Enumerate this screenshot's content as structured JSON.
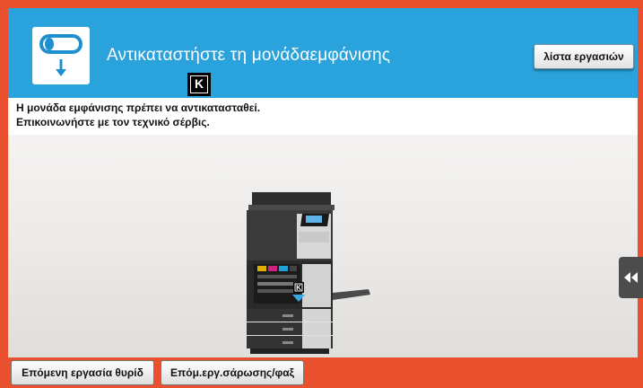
{
  "header": {
    "title": "Αντικαταστήστε τη μονάδαεμφάνισης",
    "toner_badge": "K",
    "job_list_label": "λίστα εργασιών",
    "icon": "drum-unit-replace-icon"
  },
  "message": {
    "line1": "Η μονάδα εμφάνισης πρέπει να αντικατασταθεί.",
    "line2": "Επικοινωνήστε με τον τεχνικό σέρβις."
  },
  "illustration": {
    "highlight_badge": "K",
    "icon": "printer-open-front-icon"
  },
  "side_tab": {
    "icon": "double-chevron-left-icon"
  },
  "footer": {
    "next_job_label": "Επόμενη εργασία θυρίδ",
    "next_scan_label": "Επόμ.εργ.σάρωσης/φαξ"
  },
  "colors": {
    "accent_orange": "#e8502e",
    "header_blue": "#2aa2dc"
  }
}
